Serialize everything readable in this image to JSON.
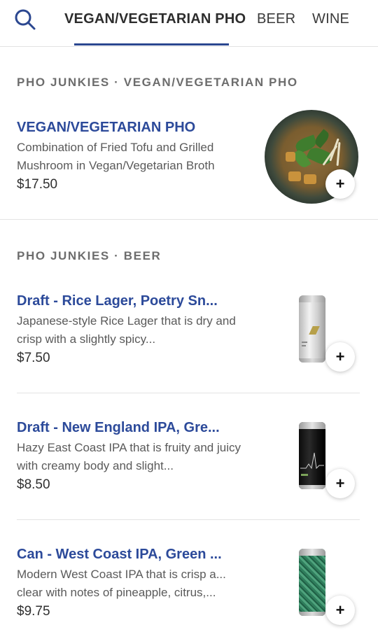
{
  "tabs": [
    {
      "label": "VEGAN/VEGETARIAN PHO"
    },
    {
      "label": "BEER"
    },
    {
      "label": "WINE"
    }
  ],
  "sections": [
    {
      "title": "PHO JUNKIES · VEGAN/VEGETARIAN PHO",
      "items": [
        {
          "title": "VEGAN/VEGETARIAN PHO",
          "desc": "Combination of Fried Tofu and Grilled Mushroom in Vegan/Vegetarian Broth",
          "price": "$17.50",
          "image": "pho-bowl-image"
        }
      ]
    },
    {
      "title": "PHO JUNKIES · BEER",
      "items": [
        {
          "title": "Draft - Rice Lager, Poetry Sn...",
          "desc": "Japanese-style Rice Lager that is dry and crisp with a slightly spicy...",
          "price": "$7.50",
          "image": "silver-can-image"
        },
        {
          "title": "Draft - New England IPA, Gre...",
          "desc": "Hazy East Coast IPA that is fruity and juicy with creamy body and slight...",
          "price": "$8.50",
          "image": "black-can-image"
        },
        {
          "title": "Can - West Coast IPA, Green ...",
          "desc": "Modern West Coast IPA that is crisp a... clear with notes of pineapple, citrus,...",
          "price": "$9.75",
          "image": "green-can-image"
        }
      ]
    }
  ],
  "add_label": "+",
  "colors": {
    "accent": "#2b4790",
    "item_title": "#2c4a9a",
    "section_title": "#6d6d6d"
  }
}
